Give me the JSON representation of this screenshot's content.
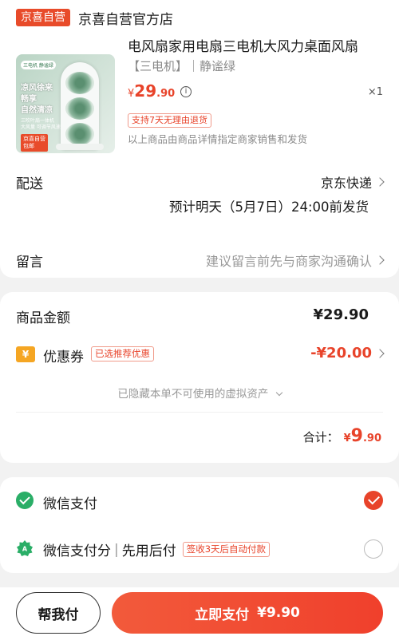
{
  "shop": {
    "badge": "京喜自营",
    "name": "京喜自营官方店"
  },
  "product": {
    "title": "电风扇家用电扇三电机大风力桌面风扇",
    "spec": "【三电机】｜静谧绿",
    "price_symbol": "¥",
    "price_int": "29",
    "price_dec": ".90",
    "quantity": "×1",
    "return_tag": "支持7天无理由退货",
    "note": "以上商品由商品详情指定商家销售和发货",
    "image_text": {
      "tag": "三电机 静谧绿",
      "headline": "凉风徐来\n畅享\n自然清凉",
      "small": "三吹叶扇一体机\n大风量 可调节风速",
      "red_tag": "京喜自营\n包邮"
    }
  },
  "delivery": {
    "label": "配送",
    "method": "京东快递",
    "estimate": "预计明天（5月7日）24:00前发货"
  },
  "message": {
    "label": "留言",
    "placeholder": "建议留言前先与商家沟通确认"
  },
  "pricing": {
    "goods_label": "商品金额",
    "goods_amount": "¥29.90",
    "coupon_icon": "¥",
    "coupon_label": "优惠券",
    "coupon_badge": "已选推荐优惠",
    "coupon_amount": "-¥20.00",
    "hidden_assets": "已隐藏本单不可使用的虚拟资产",
    "total_label": "合计：",
    "total_symbol": "¥",
    "total_int": "9",
    "total_dec": ".90"
  },
  "payment": {
    "methods": [
      {
        "label": "微信支付",
        "icon": "wechat-pay-icon",
        "selected": true
      },
      {
        "label": "微信支付分",
        "label_suffix": "先用后付",
        "badge": "签收3天后自动付款",
        "icon": "wechat-score-icon",
        "selected": false
      }
    ]
  },
  "bottom": {
    "help_label": "帮我付",
    "pay_label": "立即支付",
    "pay_amount": "¥9.90"
  },
  "colors": {
    "accent": "#e8432a",
    "wechat_green": "#2aae67",
    "coupon_gold": "#f5a623"
  }
}
